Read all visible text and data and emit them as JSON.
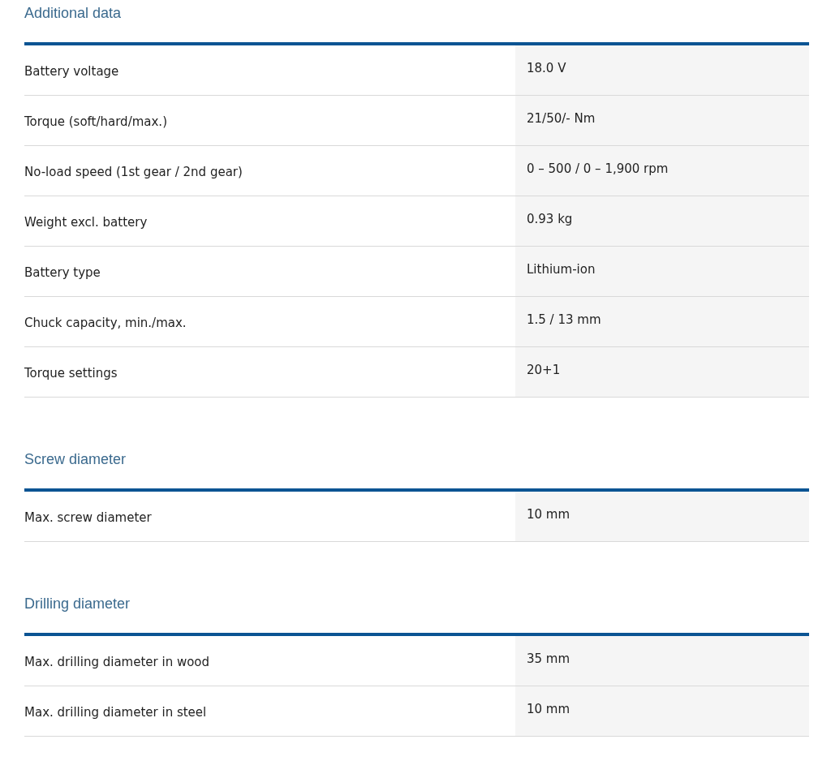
{
  "sections": [
    {
      "title": "Additional data",
      "rows": [
        {
          "label": "Battery voltage",
          "value": "18.0 V"
        },
        {
          "label": "Torque (soft/hard/max.)",
          "value": "21/50/- Nm"
        },
        {
          "label": "No-load speed (1st gear / 2nd gear)",
          "value": "0 – 500 / 0 – 1,900 rpm"
        },
        {
          "label": "Weight excl. battery",
          "value": "0.93 kg"
        },
        {
          "label": "Battery type",
          "value": "Lithium-ion"
        },
        {
          "label": "Chuck capacity, min./max.",
          "value": "1.5 / 13 mm"
        },
        {
          "label": "Torque settings",
          "value": "20+1"
        }
      ]
    },
    {
      "title": "Screw diameter",
      "rows": [
        {
          "label": "Max. screw diameter",
          "value": "10 mm"
        }
      ]
    },
    {
      "title": "Drilling diameter",
      "rows": [
        {
          "label": "Max. drilling diameter in wood",
          "value": "35 mm"
        },
        {
          "label": "Max. drilling diameter in steel",
          "value": "10 mm"
        }
      ]
    }
  ]
}
